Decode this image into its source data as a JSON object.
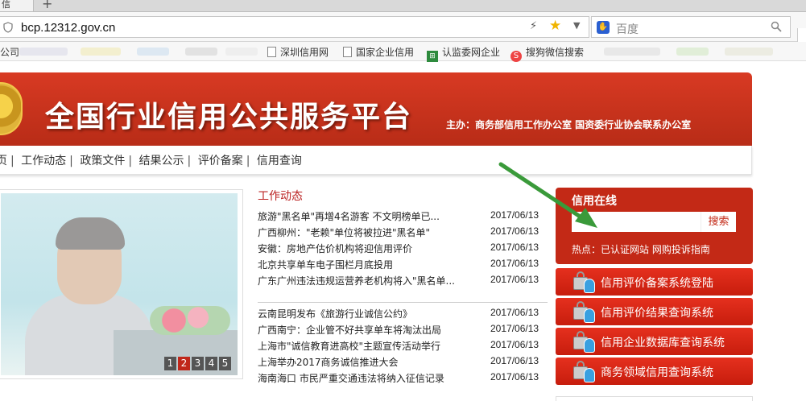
{
  "browser": {
    "tab_label": "信",
    "new_tab": "+",
    "url": "bcp.12312.gov.cn",
    "search_placeholder": "百度",
    "bookmarks": [
      {
        "label": "公司"
      },
      {
        "label": "深圳信用网"
      },
      {
        "label": "国家企业信用"
      },
      {
        "label": "认监委网企业"
      },
      {
        "label": "搜狗微信搜索"
      }
    ]
  },
  "page": {
    "banner_title": "全国行业信用公共服务平台",
    "sponsor": "主办：商务部信用工作办公室 国资委行业协会联系办公室",
    "nav": [
      "页",
      "工作动态",
      "政策文件",
      "结果公示",
      "评价备案",
      "信用查询"
    ],
    "slideshow_pages": [
      "1",
      "2",
      "3",
      "4",
      "5"
    ],
    "slideshow_active": "2",
    "news_title": "工作动态",
    "news_group1": [
      {
        "title": "旅游\"黑名单\"再增4名游客 不文明榜单已...",
        "date": "2017/06/13"
      },
      {
        "title": "广西柳州：\"老赖\"单位将被拉进\"黑名单\"",
        "date": "2017/06/13"
      },
      {
        "title": "安徽：房地产估价机构将迎信用评价",
        "date": "2017/06/13"
      },
      {
        "title": "北京共享单车电子围栏月底投用",
        "date": "2017/06/13"
      },
      {
        "title": "广东广州违法违规运营养老机构将入\"黑名单...",
        "date": "2017/06/13"
      }
    ],
    "news_group2": [
      {
        "title": "云南昆明发布《旅游行业诚信公约》",
        "date": "2017/06/13"
      },
      {
        "title": "广西南宁：企业管不好共享单车将淘汰出局",
        "date": "2017/06/13"
      },
      {
        "title": "上海市\"诚信教育进高校\"主题宣传活动举行",
        "date": "2017/06/13"
      },
      {
        "title": "上海举办2017商务诚信推进大会",
        "date": "2017/06/13"
      },
      {
        "title": "海南海口 市民严重交通违法将纳入征信记录",
        "date": "2017/06/13"
      }
    ],
    "credit_online": {
      "title": "信用在线",
      "search_button": "搜索",
      "hot": "热点：已认证网站 网购投诉指南"
    },
    "systems": [
      {
        "label": "信用评价备案系统登陆"
      },
      {
        "label": "信用评价结果查询系统"
      },
      {
        "label": "信用企业数据库查询系统"
      },
      {
        "label": "商务领域信用查询系统"
      }
    ],
    "colors": {
      "brand_red": "#c32916",
      "arrow_green": "#3a9a3a",
      "news_title_red": "#b22222"
    }
  }
}
